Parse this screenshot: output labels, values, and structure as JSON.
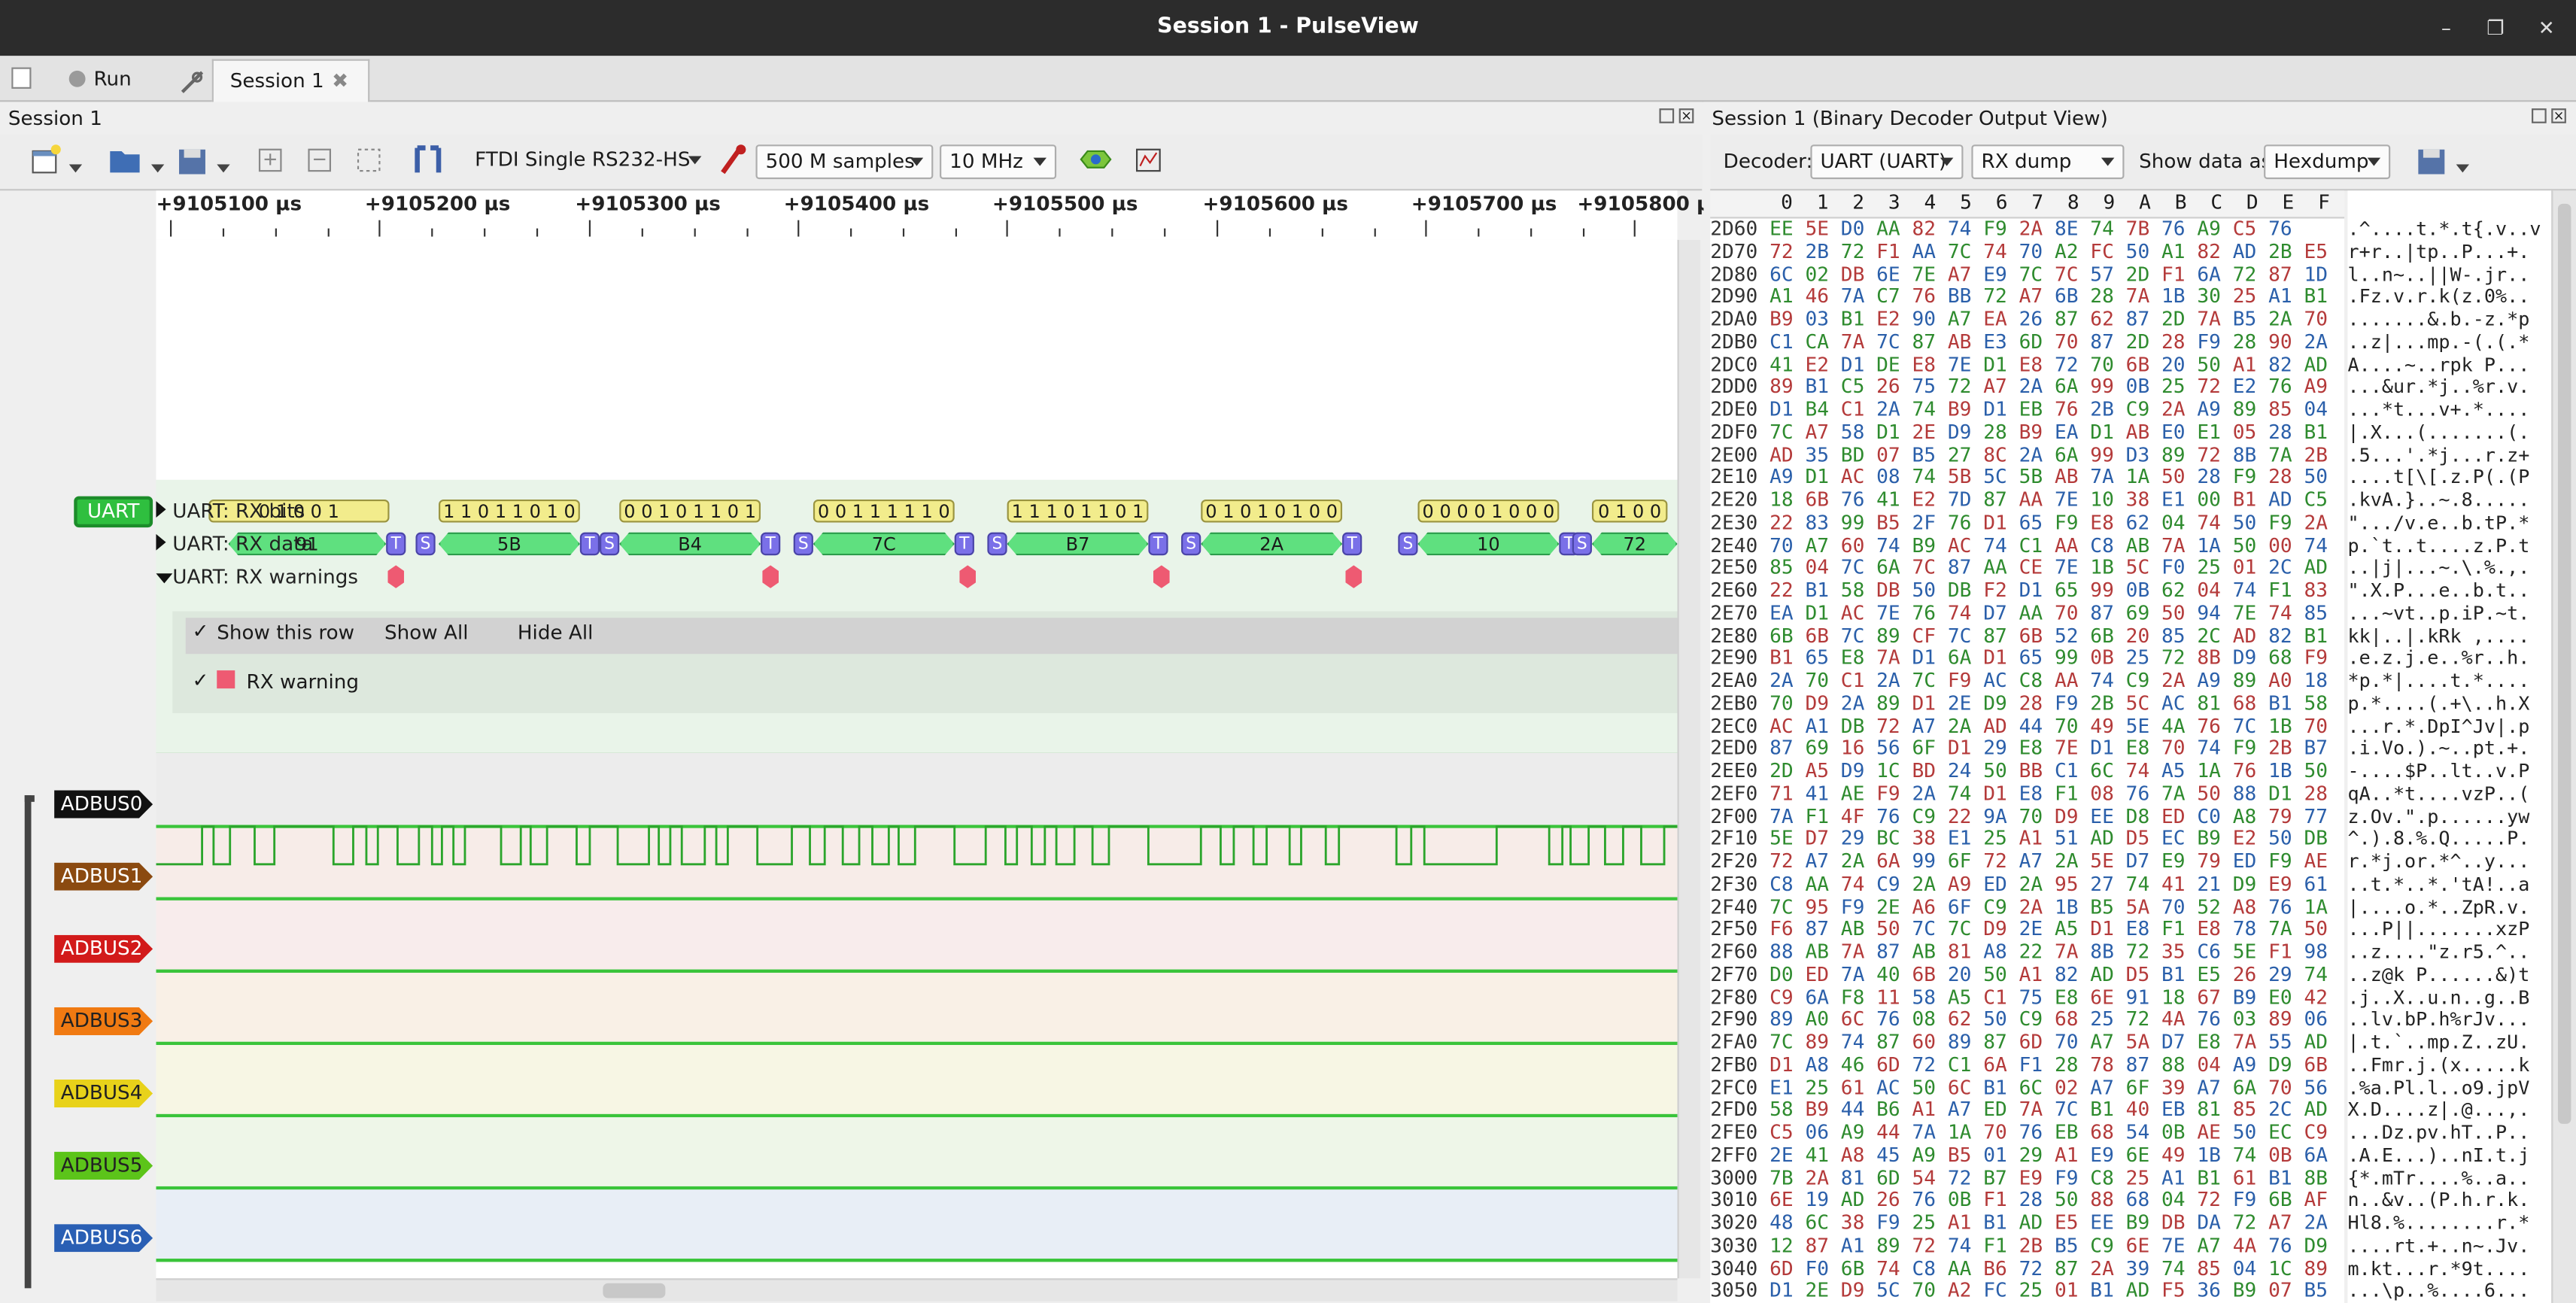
{
  "window": {
    "title": "Session 1 - PulseView"
  },
  "tabbar": {
    "run_label": "Run",
    "session_tab": "Session 1"
  },
  "left_dock": {
    "title": "Session 1",
    "device": "FTDI Single RS232-HS",
    "samples": "500 M samples",
    "rate": "10 MHz"
  },
  "ruler": {
    "labels": [
      "+9105100 µs",
      "+9105200 µs",
      "+9105300 µs",
      "+9105400 µs",
      "+9105500 µs",
      "+9105600 µs",
      "+9105700 µs",
      "+9105800 µs"
    ]
  },
  "decoder": {
    "tag": "UART",
    "rows": [
      "UART: RX bits",
      "UART: RX data",
      "UART: RX warnings"
    ],
    "show_row": "Show this row",
    "show_all": "Show All",
    "hide_all": "Hide All",
    "warning_class": "RX warning",
    "data_values": [
      "91",
      "5B",
      "B4",
      "7C",
      "B7",
      "2A",
      "10",
      "72"
    ],
    "bits": [
      "0 1 0 0 1",
      "1 1 0 1 1 0 1 0",
      "0 0 1 0 1 1 0 1",
      "0 0 1 1 1 1 1 0",
      "1 1 1 0 1 1 0 1",
      "0 1 0 1 0 1 0 0",
      "0 0 0 0 1 0 0 0",
      "0 1 0 0"
    ],
    "t_label": "T",
    "s_label": "S"
  },
  "channels": [
    "ADBUS0",
    "ADBUS1",
    "ADBUS2",
    "ADBUS3",
    "ADBUS4",
    "ADBUS5",
    "ADBUS6"
  ],
  "colors": {
    "ADBUS0": "#111111",
    "ADBUS1": "#8b4a10",
    "ADBUS2": "#d21a1a",
    "ADBUS3": "#f07a12",
    "ADBUS4": "#e8d21a",
    "ADBUS5": "#5cc41a",
    "ADBUS6": "#2a5fb4",
    "UART": "#2fbf3f"
  },
  "right_dock": {
    "title": "Session 1 (Binary Decoder Output View)",
    "decoder_label": "Decoder:",
    "decoder_value": "UART (UART)",
    "output_value": "RX dump",
    "show_as_label": "Show data as",
    "show_as_value": "Hexdump"
  },
  "hexdump": {
    "columns": [
      "0",
      "1",
      "2",
      "3",
      "4",
      "5",
      "6",
      "7",
      "8",
      "9",
      "A",
      "B",
      "C",
      "D",
      "E",
      "F"
    ],
    "rows": [
      {
        "addr": "2D60",
        "hex": "EE 5E D0 AA 82 74 F9 2A 8E 74 7B 76 A9 C5 76",
        "ascii": ".^....t.*.t{.v..v"
      },
      {
        "addr": "2D70",
        "hex": "72 2B 72 F1 AA 7C 74 70 A2 FC 50 A1 82 AD 2B E5",
        "ascii": "r+r..|tp..P...+."
      },
      {
        "addr": "2D80",
        "hex": "6C 02 DB 6E 7E A7 E9 7C 7C 57 2D F1 6A 72 87 1D",
        "ascii": "l..n~..||W-.jr.."
      },
      {
        "addr": "2D90",
        "hex": "A1 46 7A C7 76 BB 72 A7 6B 28 7A 1B 30 25 A1 B1",
        "ascii": ".Fz.v.r.k(z.0%.."
      },
      {
        "addr": "2DA0",
        "hex": "B9 03 B1 E2 90 A7 EA 26 87 62 87 2D 7A B5 2A 70",
        "ascii": ".......&.b.-z.*p"
      },
      {
        "addr": "2DB0",
        "hex": "C1 CA 7A 7C 87 AB E3 6D 70 87 2D 28 F9 28 90 2A",
        "ascii": "..z|...mp.-(.(.*"
      },
      {
        "addr": "2DC0",
        "hex": "41 E2 D1 DE E8 7E D1 E8 72 70 6B 20 50 A1 82 AD",
        "ascii": "A....~..rpk P..."
      },
      {
        "addr": "2DD0",
        "hex": "89 B1 C5 26 75 72 A7 2A 6A 99 0B 25 72 E2 76 A9",
        "ascii": "...&ur.*j..%r.v."
      },
      {
        "addr": "2DE0",
        "hex": "D1 B4 C1 2A 74 B9 D1 EB 76 2B C9 2A A9 89 85 04",
        "ascii": "...*t...v+.*...."
      },
      {
        "addr": "2DF0",
        "hex": "7C A7 58 D1 2E D9 28 B9 EA D1 AB E0 E1 05 28 B1",
        "ascii": "|.X...(.......(."
      },
      {
        "addr": "2E00",
        "hex": "AD 35 BD 07 B5 27 8C 2A 6A 99 D3 89 72 8B 7A 2B",
        "ascii": ".5...'.*j...r.z+"
      },
      {
        "addr": "2E10",
        "hex": "A9 D1 AC 08 74 5B 5C 5B AB 7A 1A 50 28 F9 28 50",
        "ascii": "....t[\\[.z.P(.(P"
      },
      {
        "addr": "2E20",
        "hex": "18 6B 76 41 E2 7D 87 AA 7E 10 38 E1 00 B1 AD C5",
        "ascii": ".kvA.}..~.8....."
      },
      {
        "addr": "2E30",
        "hex": "22 83 99 B5 2F 76 D1 65 F9 E8 62 04 74 50 F9 2A",
        "ascii": "\".../v.e..b.tP.*"
      },
      {
        "addr": "2E40",
        "hex": "70 A7 60 74 B9 AC 74 C1 AA C8 AB 7A 1A 50 00 74",
        "ascii": "p.`t..t....z.P.t"
      },
      {
        "addr": "2E50",
        "hex": "85 04 7C 6A 7C 87 AA CE 7E 1B 5C F0 25 01 2C AD",
        "ascii": "..|j|...~.\\.%.,."
      },
      {
        "addr": "2E60",
        "hex": "22 B1 58 DB 50 DB F2 D1 65 99 0B 62 04 74 F1 83",
        "ascii": "\".X.P...e..b.t.."
      },
      {
        "addr": "2E70",
        "hex": "EA D1 AC 7E 76 74 D7 AA 70 87 69 50 94 7E 74 85",
        "ascii": "...~vt..p.iP.~t."
      },
      {
        "addr": "2E80",
        "hex": "6B 6B 7C 89 CF 7C 87 6B 52 6B 20 85 2C AD 82 B1",
        "ascii": "kk|..|.kRk ,...."
      },
      {
        "addr": "2E90",
        "hex": "B1 65 E8 7A D1 6A D1 65 99 0B 25 72 8B D9 68 F9",
        "ascii": ".e.z.j.e..%r..h."
      },
      {
        "addr": "2EA0",
        "hex": "2A 70 C1 2A 7C F9 AC C8 AA 74 C9 2A A9 89 A0 18",
        "ascii": "*p.*|....t.*...."
      },
      {
        "addr": "2EB0",
        "hex": "70 D9 2A 89 D1 2E D9 28 F9 2B 5C AC 81 68 B1 58",
        "ascii": "p.*....(.+\\..h.X"
      },
      {
        "addr": "2EC0",
        "hex": "AC A1 DB 72 A7 2A AD 44 70 49 5E 4A 76 7C 1B 70",
        "ascii": "...r.*.DpI^Jv|.p"
      },
      {
        "addr": "2ED0",
        "hex": "87 69 16 56 6F D1 29 E8 7E D1 E8 70 74 F9 2B B7",
        "ascii": ".i.Vo.).~..pt.+."
      },
      {
        "addr": "2EE0",
        "hex": "2D A5 D9 1C BD 24 50 BB C1 6C 74 A5 1A 76 1B 50",
        "ascii": "-....$P..lt..v.P"
      },
      {
        "addr": "2EF0",
        "hex": "71 41 AE F9 2A 74 D1 E8 F1 08 76 7A 50 88 D1 28",
        "ascii": "qA..*t....vzP..("
      },
      {
        "addr": "2F00",
        "hex": "7A F1 4F 76 C9 22 9A 70 D9 EE D8 ED C0 A8 79 77",
        "ascii": "z.Ov.\".p......yw"
      },
      {
        "addr": "2F10",
        "hex": "5E D7 29 BC 38 E1 25 A1 51 AD D5 EC B9 E2 50 DB",
        "ascii": "^.).8.%.Q.....P."
      },
      {
        "addr": "2F20",
        "hex": "72 A7 2A 6A 99 6F 72 A7 2A 5E D7 E9 79 ED F9 AE",
        "ascii": "r.*j.or.*^..y..."
      },
      {
        "addr": "2F30",
        "hex": "C8 AA 74 C9 2A A9 ED 2A 95 27 74 41 21 D9 E9 61",
        "ascii": "..t.*..*.'tA!..a"
      },
      {
        "addr": "2F40",
        "hex": "7C 95 F9 2E A6 6F C9 2A 1B B5 5A 70 52 A8 76 1A",
        "ascii": "|....o.*..ZpR.v."
      },
      {
        "addr": "2F50",
        "hex": "F6 87 AB 50 7C 7C D9 2E A5 D1 E8 F1 E8 78 7A 50",
        "ascii": "...P||.......xzP"
      },
      {
        "addr": "2F60",
        "hex": "88 AB 7A 87 AB 81 A8 22 7A 8B 72 35 C6 5E F1 98",
        "ascii": "..z....\"z.r5.^.."
      },
      {
        "addr": "2F70",
        "hex": "D0 ED 7A 40 6B 20 50 A1 82 AD D5 B1 E5 26 29 74",
        "ascii": "..z@k P......&)t"
      },
      {
        "addr": "2F80",
        "hex": "C9 6A F8 11 58 A5 C1 75 E8 6E 91 18 67 B9 E0 42",
        "ascii": ".j..X..u.n..g..B"
      },
      {
        "addr": "2F90",
        "hex": "89 A0 6C 76 08 62 50 C9 68 25 72 4A 76 03 89 06",
        "ascii": "..lv.bP.h%rJv..."
      },
      {
        "addr": "2FA0",
        "hex": "7C 89 74 87 60 89 87 6D 70 A7 5A D7 E8 7A 55 AD",
        "ascii": "|.t.`..mp.Z..zU."
      },
      {
        "addr": "2FB0",
        "hex": "D1 A8 46 6D 72 C1 6A F1 28 78 87 88 04 A9 D9 6B",
        "ascii": "..Fmr.j.(x.....k"
      },
      {
        "addr": "2FC0",
        "hex": "E1 25 61 AC 50 6C B1 6C 02 A7 6F 39 A7 6A 70 56",
        "ascii": ".%a.Pl.l..o9.jpV"
      },
      {
        "addr": "2FD0",
        "hex": "58 B9 44 B6 A1 A7 ED 7A 7C B1 40 EB 81 85 2C AD",
        "ascii": "X.D....z|.@...,."
      },
      {
        "addr": "2FE0",
        "hex": "C5 06 A9 44 7A 1A 70 76 EB 68 54 0B AE 50 EC C9",
        "ascii": "...Dz.pv.hT..P.."
      },
      {
        "addr": "2FF0",
        "hex": "2E 41 A8 45 A9 B5 01 29 A1 E9 6E 49 1B 74 0B 6A",
        "ascii": ".A.E...)..nI.t.j"
      },
      {
        "addr": "3000",
        "hex": "7B 2A 81 6D 54 72 B7 E9 F9 C8 25 A1 B1 61 B1 8B",
        "ascii": "{*.mTr....%..a.."
      },
      {
        "addr": "3010",
        "hex": "6E 19 AD 26 76 0B F1 28 50 88 68 04 72 F9 6B AF",
        "ascii": "n..&v..(P.h.r.k."
      },
      {
        "addr": "3020",
        "hex": "48 6C 38 F9 25 A1 B1 AD E5 EE B9 DB DA 72 A7 2A",
        "ascii": "Hl8.%........r.*"
      },
      {
        "addr": "3030",
        "hex": "12 87 A1 89 72 74 F1 2B B5 C9 6E 7E A7 4A 76 D9",
        "ascii": "....rt.+..n~.Jv."
      },
      {
        "addr": "3040",
        "hex": "6D F0 6B 74 C8 AA B6 72 87 2A 39 74 85 04 1C 89",
        "ascii": "m.kt...r.*9t...."
      },
      {
        "addr": "3050",
        "hex": "D1 2E D9 5C 70 A2 FC 25 01 B1 AD F5 36 B9 07 B5",
        "ascii": "...\\p..%....6..."
      }
    ]
  }
}
